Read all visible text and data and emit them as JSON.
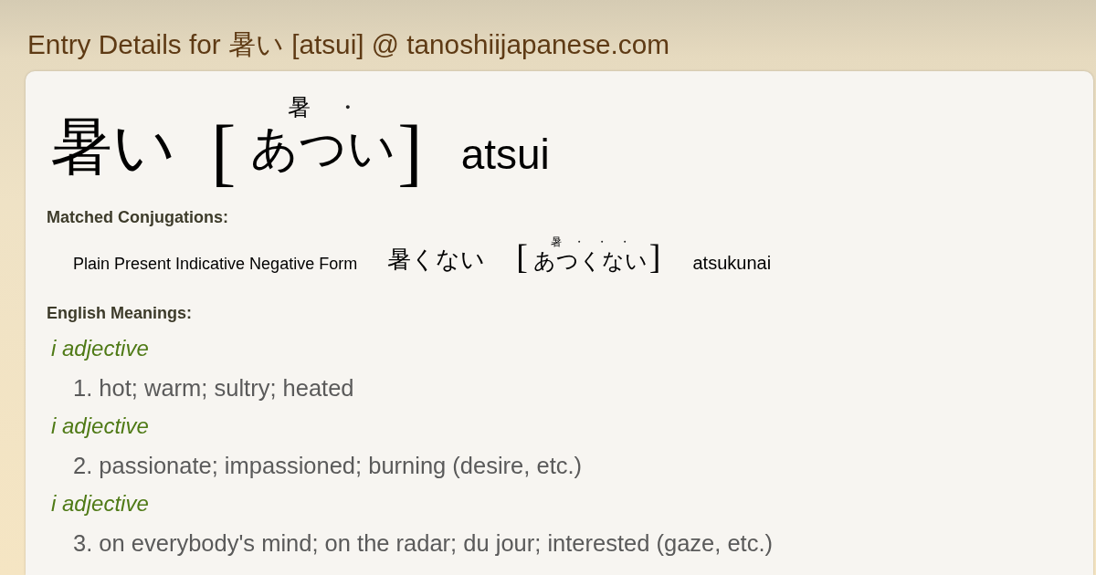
{
  "page": {
    "title": "Entry Details for 暑い [atsui] @ tanoshiijapanese.com"
  },
  "entry": {
    "word": "暑い",
    "reading": {
      "open": "[",
      "segments": [
        {
          "kind": "kanji",
          "kana": "あつ",
          "ruby": "暑"
        },
        {
          "kind": "okurigana",
          "kana": "い",
          "ruby": "・"
        }
      ],
      "close": "]"
    },
    "romaji": "atsui"
  },
  "conjugations": {
    "heading": "Matched Conjugations:",
    "items": [
      {
        "form": "Plain Present Indicative Negative Form",
        "word": "暑くない",
        "reading": {
          "open": "[",
          "segments": [
            {
              "kind": "kanji",
              "kana": "あつ",
              "ruby": "暑"
            },
            {
              "kind": "okurigana",
              "kana": "く",
              "ruby": "・"
            },
            {
              "kind": "okurigana",
              "kana": "な",
              "ruby": "・"
            },
            {
              "kind": "okurigana",
              "kana": "い",
              "ruby": "・"
            }
          ],
          "close": "]"
        },
        "romaji": "atsukunai"
      }
    ]
  },
  "meanings": {
    "heading": "English Meanings:",
    "senses": [
      {
        "pos": "i adjective",
        "gloss": "1. hot; warm; sultry; heated"
      },
      {
        "pos": "i adjective",
        "gloss": "2. passionate; impassioned; burning (desire, etc.)"
      },
      {
        "pos": "i adjective",
        "gloss": "3. on everybody's mind; on the radar; du jour; interested (gaze, etc.)"
      }
    ]
  }
}
